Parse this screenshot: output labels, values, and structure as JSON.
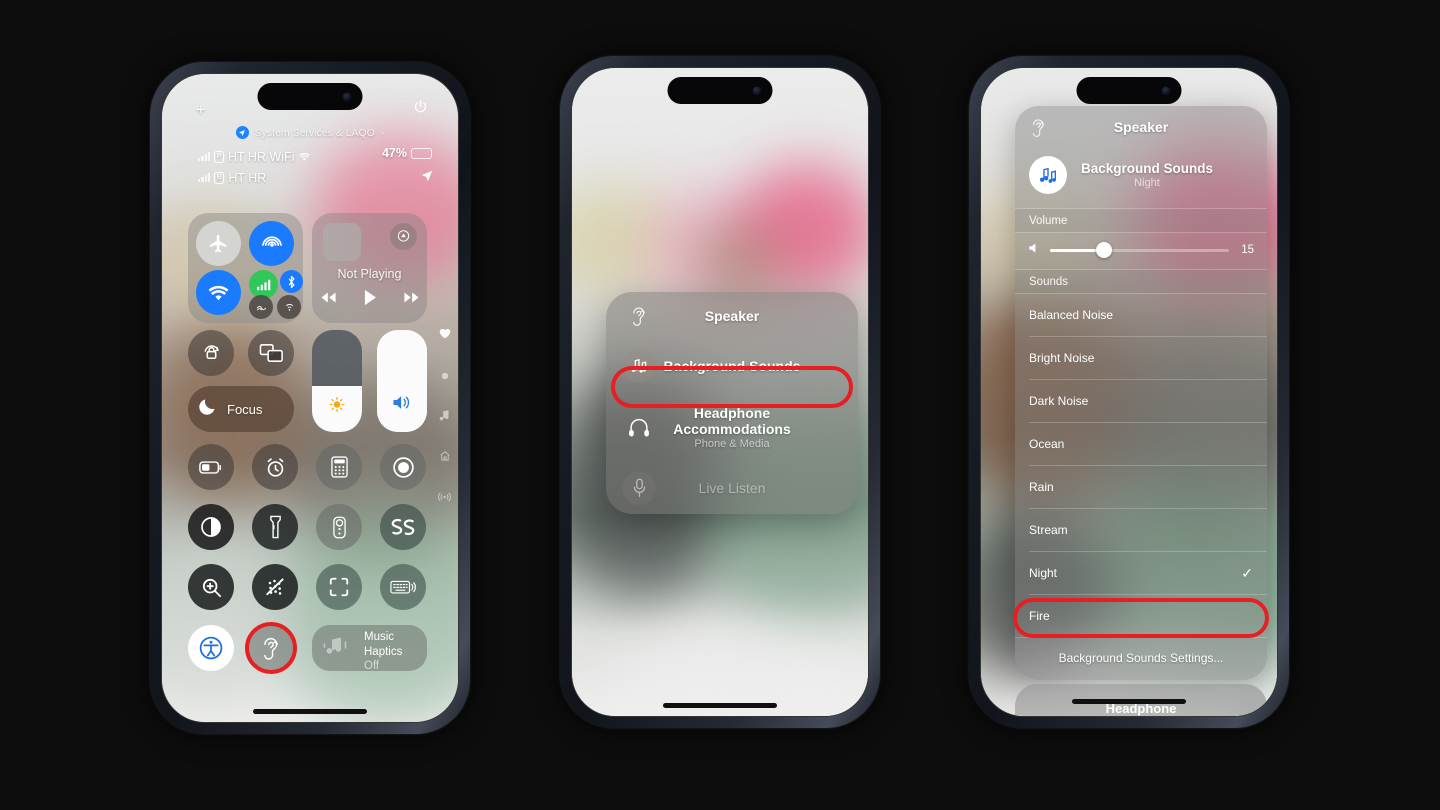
{
  "background_color": "#0d0d0d",
  "highlight_color": "#e51f22",
  "phone1": {
    "name": "iPhone Control Center",
    "status": {
      "add_label": "+",
      "system_services": "System Services & LAQO",
      "chevron": "›",
      "carrier_1": "HT HR WiFi",
      "carrier_1_sim": "P",
      "carrier_2": "HT HR",
      "carrier_2_sim": "B",
      "battery_percent": "47%",
      "battery_level": 47
    },
    "connectivity": {
      "airplane_mode": "Airplane Mode",
      "airdrop": "AirDrop",
      "wifi": "Wi-Fi",
      "cellular_data": "Cellular Data",
      "bluetooth": "Bluetooth",
      "vpn": "VPN",
      "personal_hotspot": "Personal Hotspot"
    },
    "media": {
      "title": "Not Playing",
      "airplay": "AirPlay",
      "rewind": "Rewind",
      "play": "Play",
      "forward": "Fast Forward"
    },
    "controls": {
      "rotation_lock": "Rotation Lock",
      "screen_mirroring": "Screen Mirroring",
      "focus": "Focus",
      "brightness_label": "Brightness",
      "brightness_value": 45,
      "volume_label": "Volume",
      "volume_value": 100
    },
    "tiles": [
      {
        "name": "low-power-mode",
        "label": "Low Power Mode",
        "style": "warm"
      },
      {
        "name": "alarm",
        "label": "Alarm",
        "style": "warm"
      },
      {
        "name": "calculator",
        "label": "Calculator",
        "style": "grey"
      },
      {
        "name": "screen-recording",
        "label": "Screen Recording",
        "style": "grey"
      },
      {
        "name": "dark-mode",
        "label": "Dark Mode",
        "style": "dark"
      },
      {
        "name": "flashlight",
        "label": "Flashlight",
        "style": "dark"
      },
      {
        "name": "apple-tv-remote",
        "label": "Apple TV Remote",
        "style": "grey"
      },
      {
        "name": "shazam",
        "label": "Music Recognition",
        "style": "green"
      },
      {
        "name": "magnifier",
        "label": "Magnifier",
        "style": "dark"
      },
      {
        "name": "silence-notifications",
        "label": "Silence Notifications",
        "style": "dark"
      },
      {
        "name": "code-scanner",
        "label": "Code Scanner",
        "style": "green"
      },
      {
        "name": "keyboard-haptics",
        "label": "Keyboard",
        "style": "green"
      }
    ],
    "bottom": {
      "accessibility_shortcuts": "Accessibility Shortcuts",
      "hearing": "Hearing",
      "music_haptics_title": "Music",
      "music_haptics_title2": "Haptics",
      "music_haptics_state": "Off"
    },
    "rail": [
      {
        "name": "favorites",
        "icon": "heart-icon"
      },
      {
        "name": "page-dot",
        "icon": "dot-icon"
      },
      {
        "name": "media-page",
        "icon": "music-note-icon"
      },
      {
        "name": "home-page",
        "icon": "home-icon"
      },
      {
        "name": "connectivity-page",
        "icon": "signal-icon"
      }
    ]
  },
  "phone2": {
    "name": "Hearing Control Menu",
    "menu": [
      {
        "name": "speaker",
        "icon": "ear-icon",
        "label": "Speaker",
        "sub": "",
        "dim": false,
        "highlighted": false
      },
      {
        "name": "background-sounds",
        "icon": "music-notes-icon",
        "label": "Background Sounds",
        "sub": "",
        "dim": false,
        "highlighted": true
      },
      {
        "name": "headphone-accommodations",
        "icon": "headphones-icon",
        "label": "Headphone Accommodations",
        "sub": "Phone & Media",
        "dim": false,
        "highlighted": false
      },
      {
        "name": "live-listen",
        "icon": "microphone-icon",
        "label": "Live Listen",
        "sub": "",
        "dim": true,
        "highlighted": false
      }
    ],
    "headphone_line1": "Headphone",
    "headphone_line2": "Accommodations"
  },
  "phone3": {
    "name": "Background Sounds Panel",
    "header": "Speaker",
    "active": {
      "title": "Background Sounds",
      "subtitle": "Night",
      "icon": "music-notes-icon"
    },
    "volume": {
      "label": "Volume",
      "value": "15",
      "percent": 15,
      "mute_icon": "speaker-icon"
    },
    "sounds_label": "Sounds",
    "sounds": [
      {
        "name": "balanced-noise",
        "label": "Balanced Noise",
        "selected": false,
        "highlighted": false
      },
      {
        "name": "bright-noise",
        "label": "Bright Noise",
        "selected": false,
        "highlighted": false
      },
      {
        "name": "dark-noise",
        "label": "Dark Noise",
        "selected": false,
        "highlighted": false
      },
      {
        "name": "ocean",
        "label": "Ocean",
        "selected": false,
        "highlighted": false
      },
      {
        "name": "rain",
        "label": "Rain",
        "selected": false,
        "highlighted": false
      },
      {
        "name": "stream",
        "label": "Stream",
        "selected": false,
        "highlighted": false
      },
      {
        "name": "night",
        "label": "Night",
        "selected": true,
        "highlighted": true
      },
      {
        "name": "fire",
        "label": "Fire",
        "selected": false,
        "highlighted": false
      }
    ],
    "settings_link": "Background Sounds Settings...",
    "stub_label": "Headphone",
    "checkmark": "✓"
  }
}
